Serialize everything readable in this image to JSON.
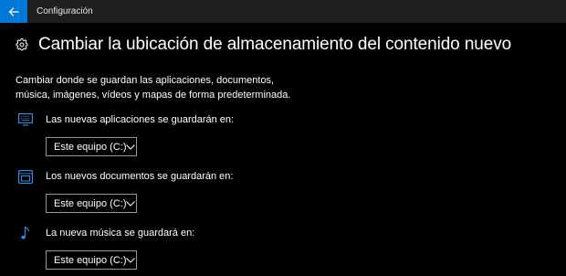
{
  "window": {
    "title": "Configuración"
  },
  "page": {
    "title": "Cambiar la ubicación de almacenamiento del contenido nuevo",
    "description": "Cambiar donde se guardan las aplicaciones, documentos, música, imágenes, vídeos y mapas de forma predeterminada."
  },
  "sections": [
    {
      "icon": "monitor-icon",
      "label": "Las nuevas aplicaciones se guardarán en:",
      "selected": "Este equipo (C:)"
    },
    {
      "icon": "document-folder-icon",
      "label": "Los nuevos documentos se guardarán en:",
      "selected": "Este equipo (C:)"
    },
    {
      "icon": "music-note-icon",
      "label": "La nueva música se guardará en:",
      "selected": "Este equipo (C:)"
    }
  ],
  "colors": {
    "accent": "#0078d7",
    "background": "#000000",
    "titlebar": "#1f1f1f"
  }
}
